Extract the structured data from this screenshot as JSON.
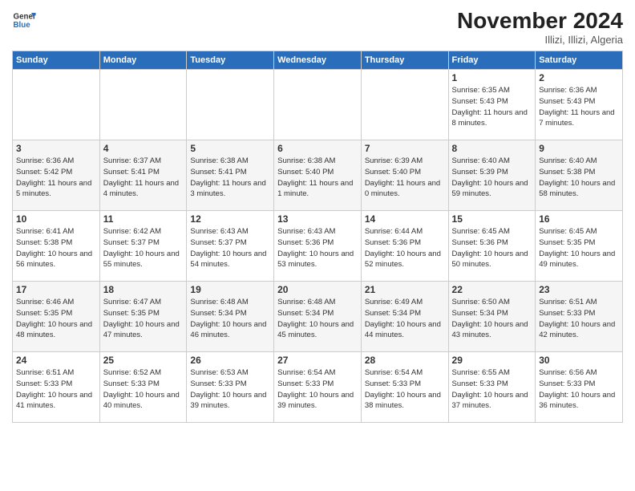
{
  "header": {
    "logo_line1": "General",
    "logo_line2": "Blue",
    "month_title": "November 2024",
    "subtitle": "Illizi, Illizi, Algeria"
  },
  "weekdays": [
    "Sunday",
    "Monday",
    "Tuesday",
    "Wednesday",
    "Thursday",
    "Friday",
    "Saturday"
  ],
  "weeks": [
    [
      {
        "day": "",
        "info": ""
      },
      {
        "day": "",
        "info": ""
      },
      {
        "day": "",
        "info": ""
      },
      {
        "day": "",
        "info": ""
      },
      {
        "day": "",
        "info": ""
      },
      {
        "day": "1",
        "info": "Sunrise: 6:35 AM\nSunset: 5:43 PM\nDaylight: 11 hours and 8 minutes."
      },
      {
        "day": "2",
        "info": "Sunrise: 6:36 AM\nSunset: 5:43 PM\nDaylight: 11 hours and 7 minutes."
      }
    ],
    [
      {
        "day": "3",
        "info": "Sunrise: 6:36 AM\nSunset: 5:42 PM\nDaylight: 11 hours and 5 minutes."
      },
      {
        "day": "4",
        "info": "Sunrise: 6:37 AM\nSunset: 5:41 PM\nDaylight: 11 hours and 4 minutes."
      },
      {
        "day": "5",
        "info": "Sunrise: 6:38 AM\nSunset: 5:41 PM\nDaylight: 11 hours and 3 minutes."
      },
      {
        "day": "6",
        "info": "Sunrise: 6:38 AM\nSunset: 5:40 PM\nDaylight: 11 hours and 1 minute."
      },
      {
        "day": "7",
        "info": "Sunrise: 6:39 AM\nSunset: 5:40 PM\nDaylight: 11 hours and 0 minutes."
      },
      {
        "day": "8",
        "info": "Sunrise: 6:40 AM\nSunset: 5:39 PM\nDaylight: 10 hours and 59 minutes."
      },
      {
        "day": "9",
        "info": "Sunrise: 6:40 AM\nSunset: 5:38 PM\nDaylight: 10 hours and 58 minutes."
      }
    ],
    [
      {
        "day": "10",
        "info": "Sunrise: 6:41 AM\nSunset: 5:38 PM\nDaylight: 10 hours and 56 minutes."
      },
      {
        "day": "11",
        "info": "Sunrise: 6:42 AM\nSunset: 5:37 PM\nDaylight: 10 hours and 55 minutes."
      },
      {
        "day": "12",
        "info": "Sunrise: 6:43 AM\nSunset: 5:37 PM\nDaylight: 10 hours and 54 minutes."
      },
      {
        "day": "13",
        "info": "Sunrise: 6:43 AM\nSunset: 5:36 PM\nDaylight: 10 hours and 53 minutes."
      },
      {
        "day": "14",
        "info": "Sunrise: 6:44 AM\nSunset: 5:36 PM\nDaylight: 10 hours and 52 minutes."
      },
      {
        "day": "15",
        "info": "Sunrise: 6:45 AM\nSunset: 5:36 PM\nDaylight: 10 hours and 50 minutes."
      },
      {
        "day": "16",
        "info": "Sunrise: 6:45 AM\nSunset: 5:35 PM\nDaylight: 10 hours and 49 minutes."
      }
    ],
    [
      {
        "day": "17",
        "info": "Sunrise: 6:46 AM\nSunset: 5:35 PM\nDaylight: 10 hours and 48 minutes."
      },
      {
        "day": "18",
        "info": "Sunrise: 6:47 AM\nSunset: 5:35 PM\nDaylight: 10 hours and 47 minutes."
      },
      {
        "day": "19",
        "info": "Sunrise: 6:48 AM\nSunset: 5:34 PM\nDaylight: 10 hours and 46 minutes."
      },
      {
        "day": "20",
        "info": "Sunrise: 6:48 AM\nSunset: 5:34 PM\nDaylight: 10 hours and 45 minutes."
      },
      {
        "day": "21",
        "info": "Sunrise: 6:49 AM\nSunset: 5:34 PM\nDaylight: 10 hours and 44 minutes."
      },
      {
        "day": "22",
        "info": "Sunrise: 6:50 AM\nSunset: 5:34 PM\nDaylight: 10 hours and 43 minutes."
      },
      {
        "day": "23",
        "info": "Sunrise: 6:51 AM\nSunset: 5:33 PM\nDaylight: 10 hours and 42 minutes."
      }
    ],
    [
      {
        "day": "24",
        "info": "Sunrise: 6:51 AM\nSunset: 5:33 PM\nDaylight: 10 hours and 41 minutes."
      },
      {
        "day": "25",
        "info": "Sunrise: 6:52 AM\nSunset: 5:33 PM\nDaylight: 10 hours and 40 minutes."
      },
      {
        "day": "26",
        "info": "Sunrise: 6:53 AM\nSunset: 5:33 PM\nDaylight: 10 hours and 39 minutes."
      },
      {
        "day": "27",
        "info": "Sunrise: 6:54 AM\nSunset: 5:33 PM\nDaylight: 10 hours and 39 minutes."
      },
      {
        "day": "28",
        "info": "Sunrise: 6:54 AM\nSunset: 5:33 PM\nDaylight: 10 hours and 38 minutes."
      },
      {
        "day": "29",
        "info": "Sunrise: 6:55 AM\nSunset: 5:33 PM\nDaylight: 10 hours and 37 minutes."
      },
      {
        "day": "30",
        "info": "Sunrise: 6:56 AM\nSunset: 5:33 PM\nDaylight: 10 hours and 36 minutes."
      }
    ]
  ]
}
